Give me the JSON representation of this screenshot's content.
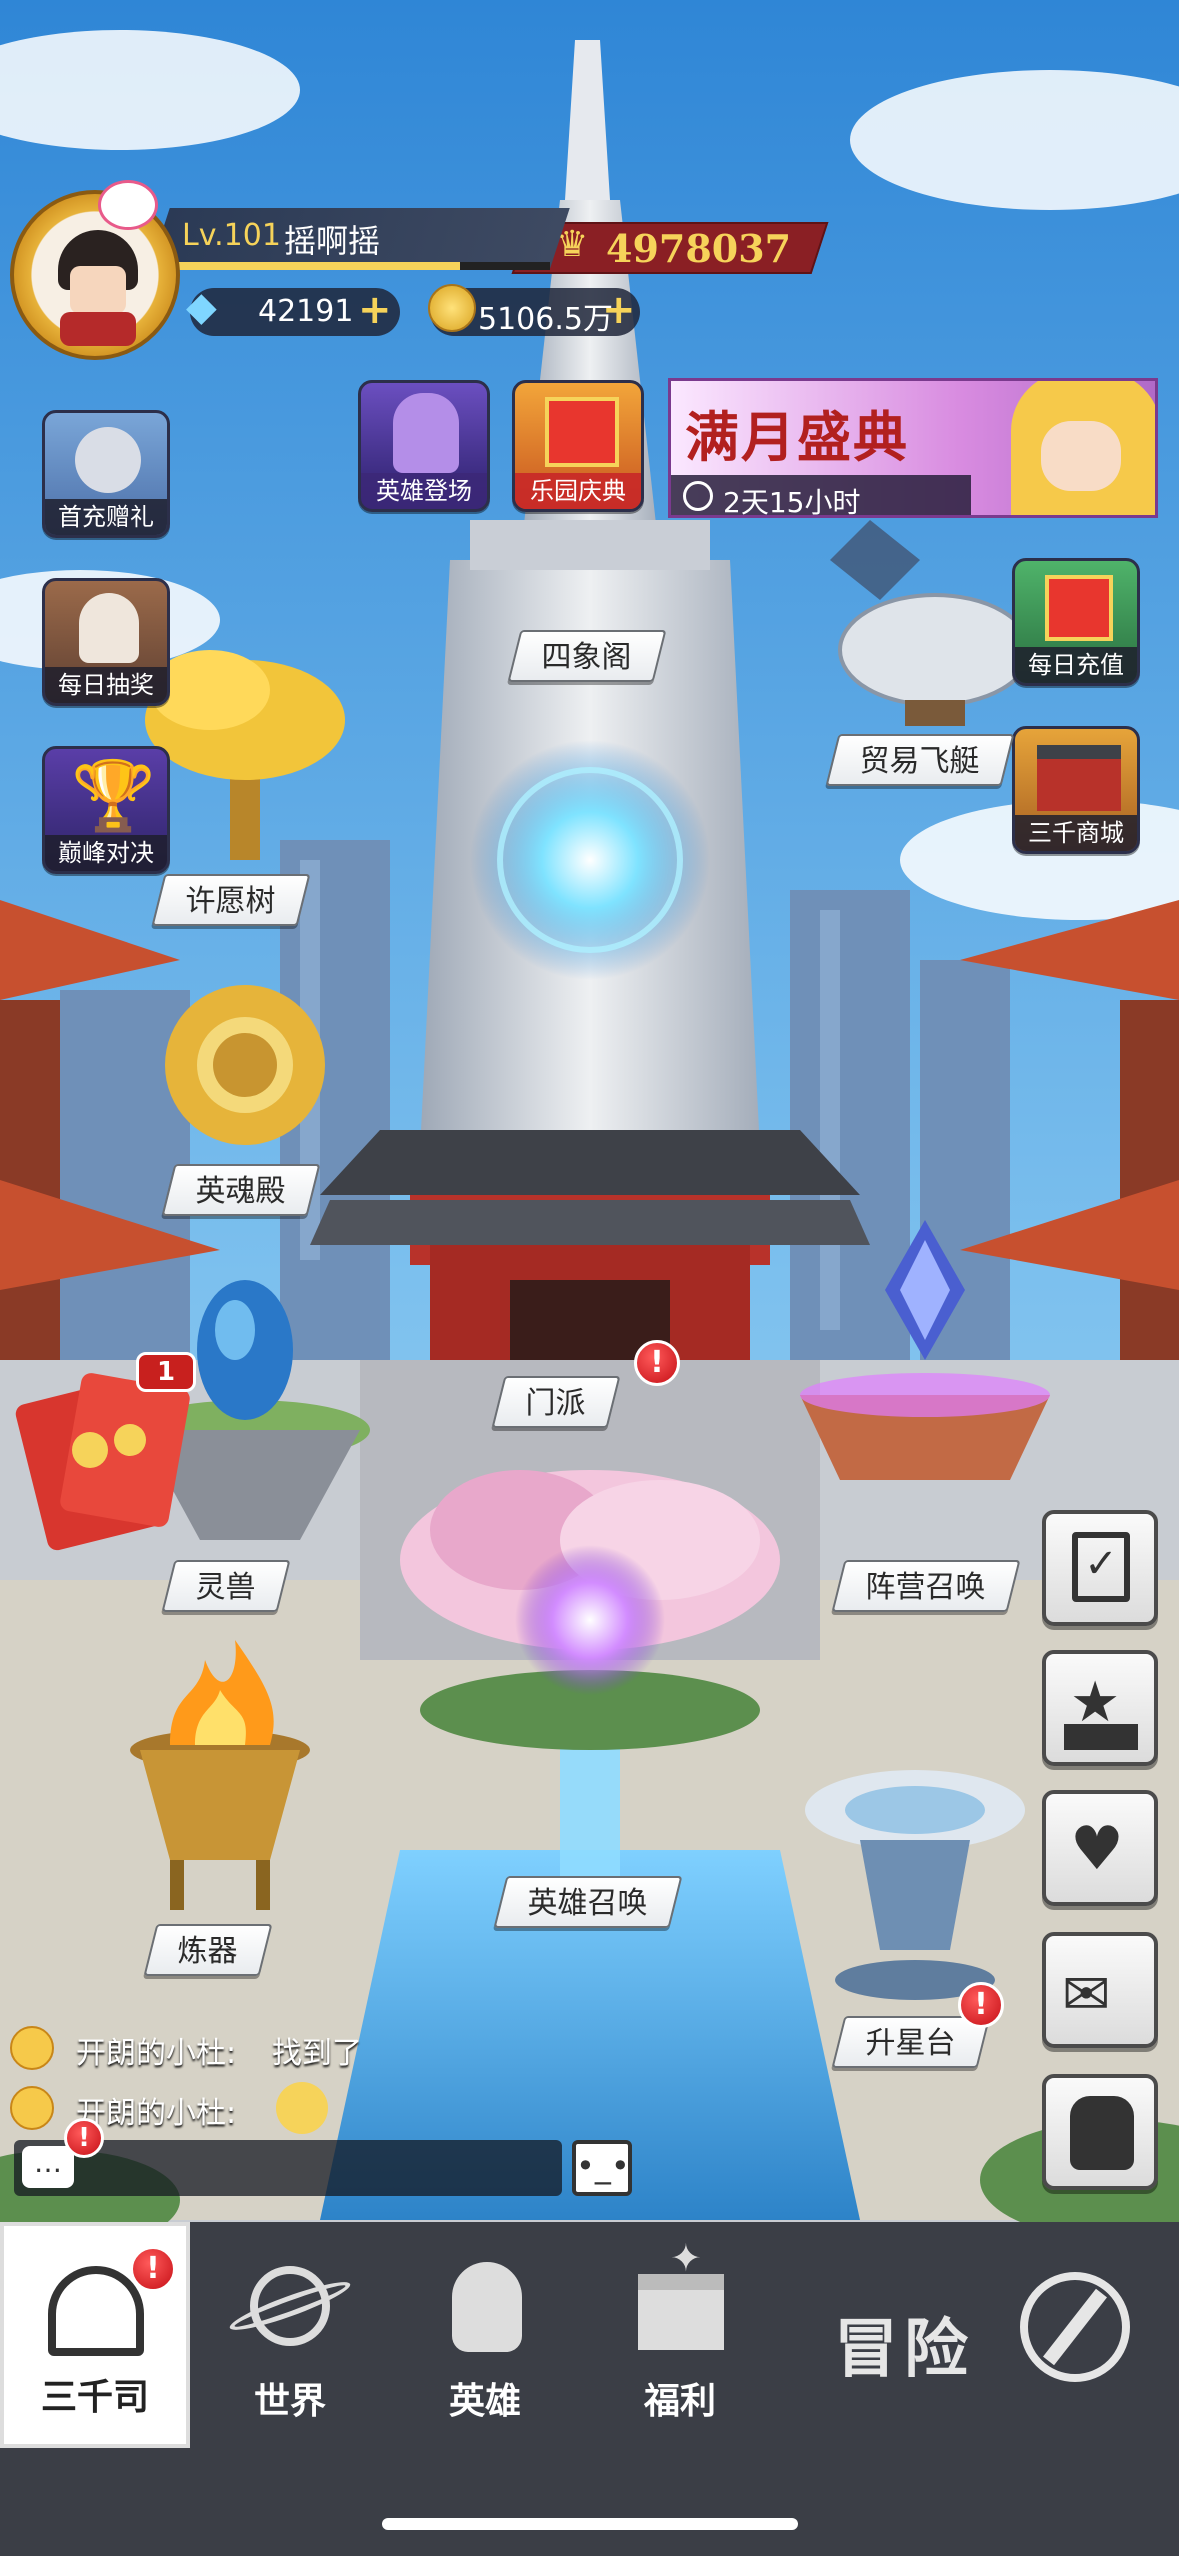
{
  "player": {
    "level": "Lv.101",
    "name": "摇啊摇",
    "power": "4978037",
    "diamonds": "42191",
    "gold": "5106.5万"
  },
  "left_icons": [
    {
      "label": "首充赠礼"
    },
    {
      "label": "每日抽奖"
    },
    {
      "label": "巅峰对决"
    }
  ],
  "top_events": [
    {
      "label": "英雄登场"
    },
    {
      "label": "乐园庆典"
    }
  ],
  "banner": {
    "title": "满月盛典",
    "timer": "2天15小时"
  },
  "right_icons": [
    {
      "label": "每日充值"
    },
    {
      "label": "三千商城"
    }
  ],
  "buildings": {
    "sixiangge": "四象阁",
    "maoyi": "贸易飞艇",
    "xuyuanshu": "许愿树",
    "yinghundian": "英魂殿",
    "menpai": "门派",
    "lingshou": "灵兽",
    "zhenying": "阵营召唤",
    "lianqi": "炼器",
    "yingxiong": "英雄召唤",
    "shengxing": "升星台"
  },
  "red_envelope_count": "1",
  "chat": [
    {
      "name": "开朗的小杜:",
      "text": "找到了"
    },
    {
      "name": "开朗的小杜:",
      "text": ""
    }
  ],
  "nav": {
    "home": "三千司",
    "world": "世界",
    "heroes": "英雄",
    "welfare": "福利",
    "adventure": "冒险"
  },
  "colors": {
    "sky": "#5aa4e0",
    "nav_bg": "#3b3e46",
    "power_bar": "#8a1f24",
    "badge_red": "#d4161e",
    "gold_text": "#f6d35a"
  }
}
